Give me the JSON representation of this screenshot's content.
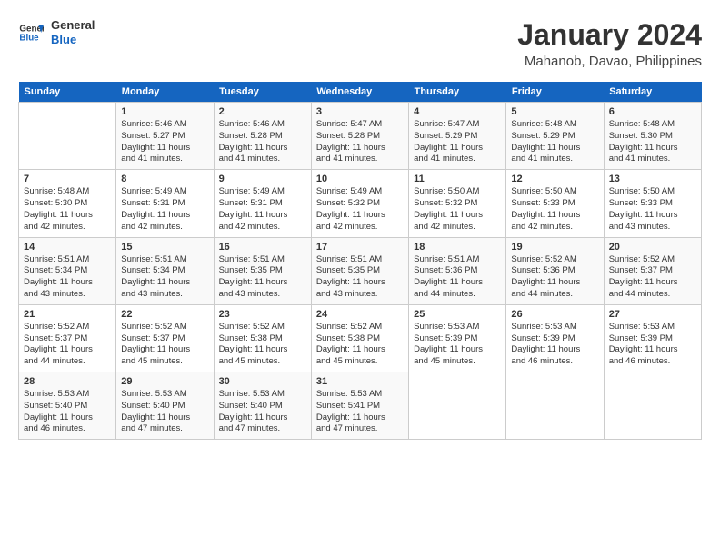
{
  "header": {
    "logo_line1": "General",
    "logo_line2": "Blue",
    "month_title": "January 2024",
    "location": "Mahanob, Davao, Philippines"
  },
  "days_of_week": [
    "Sunday",
    "Monday",
    "Tuesday",
    "Wednesday",
    "Thursday",
    "Friday",
    "Saturday"
  ],
  "weeks": [
    [
      {
        "day": "",
        "info": ""
      },
      {
        "day": "1",
        "info": "Sunrise: 5:46 AM\nSunset: 5:27 PM\nDaylight: 11 hours\nand 41 minutes."
      },
      {
        "day": "2",
        "info": "Sunrise: 5:46 AM\nSunset: 5:28 PM\nDaylight: 11 hours\nand 41 minutes."
      },
      {
        "day": "3",
        "info": "Sunrise: 5:47 AM\nSunset: 5:28 PM\nDaylight: 11 hours\nand 41 minutes."
      },
      {
        "day": "4",
        "info": "Sunrise: 5:47 AM\nSunset: 5:29 PM\nDaylight: 11 hours\nand 41 minutes."
      },
      {
        "day": "5",
        "info": "Sunrise: 5:48 AM\nSunset: 5:29 PM\nDaylight: 11 hours\nand 41 minutes."
      },
      {
        "day": "6",
        "info": "Sunrise: 5:48 AM\nSunset: 5:30 PM\nDaylight: 11 hours\nand 41 minutes."
      }
    ],
    [
      {
        "day": "7",
        "info": "Sunrise: 5:48 AM\nSunset: 5:30 PM\nDaylight: 11 hours\nand 42 minutes."
      },
      {
        "day": "8",
        "info": "Sunrise: 5:49 AM\nSunset: 5:31 PM\nDaylight: 11 hours\nand 42 minutes."
      },
      {
        "day": "9",
        "info": "Sunrise: 5:49 AM\nSunset: 5:31 PM\nDaylight: 11 hours\nand 42 minutes."
      },
      {
        "day": "10",
        "info": "Sunrise: 5:49 AM\nSunset: 5:32 PM\nDaylight: 11 hours\nand 42 minutes."
      },
      {
        "day": "11",
        "info": "Sunrise: 5:50 AM\nSunset: 5:32 PM\nDaylight: 11 hours\nand 42 minutes."
      },
      {
        "day": "12",
        "info": "Sunrise: 5:50 AM\nSunset: 5:33 PM\nDaylight: 11 hours\nand 42 minutes."
      },
      {
        "day": "13",
        "info": "Sunrise: 5:50 AM\nSunset: 5:33 PM\nDaylight: 11 hours\nand 43 minutes."
      }
    ],
    [
      {
        "day": "14",
        "info": "Sunrise: 5:51 AM\nSunset: 5:34 PM\nDaylight: 11 hours\nand 43 minutes."
      },
      {
        "day": "15",
        "info": "Sunrise: 5:51 AM\nSunset: 5:34 PM\nDaylight: 11 hours\nand 43 minutes."
      },
      {
        "day": "16",
        "info": "Sunrise: 5:51 AM\nSunset: 5:35 PM\nDaylight: 11 hours\nand 43 minutes."
      },
      {
        "day": "17",
        "info": "Sunrise: 5:51 AM\nSunset: 5:35 PM\nDaylight: 11 hours\nand 43 minutes."
      },
      {
        "day": "18",
        "info": "Sunrise: 5:51 AM\nSunset: 5:36 PM\nDaylight: 11 hours\nand 44 minutes."
      },
      {
        "day": "19",
        "info": "Sunrise: 5:52 AM\nSunset: 5:36 PM\nDaylight: 11 hours\nand 44 minutes."
      },
      {
        "day": "20",
        "info": "Sunrise: 5:52 AM\nSunset: 5:37 PM\nDaylight: 11 hours\nand 44 minutes."
      }
    ],
    [
      {
        "day": "21",
        "info": "Sunrise: 5:52 AM\nSunset: 5:37 PM\nDaylight: 11 hours\nand 44 minutes."
      },
      {
        "day": "22",
        "info": "Sunrise: 5:52 AM\nSunset: 5:37 PM\nDaylight: 11 hours\nand 45 minutes."
      },
      {
        "day": "23",
        "info": "Sunrise: 5:52 AM\nSunset: 5:38 PM\nDaylight: 11 hours\nand 45 minutes."
      },
      {
        "day": "24",
        "info": "Sunrise: 5:52 AM\nSunset: 5:38 PM\nDaylight: 11 hours\nand 45 minutes."
      },
      {
        "day": "25",
        "info": "Sunrise: 5:53 AM\nSunset: 5:39 PM\nDaylight: 11 hours\nand 45 minutes."
      },
      {
        "day": "26",
        "info": "Sunrise: 5:53 AM\nSunset: 5:39 PM\nDaylight: 11 hours\nand 46 minutes."
      },
      {
        "day": "27",
        "info": "Sunrise: 5:53 AM\nSunset: 5:39 PM\nDaylight: 11 hours\nand 46 minutes."
      }
    ],
    [
      {
        "day": "28",
        "info": "Sunrise: 5:53 AM\nSunset: 5:40 PM\nDaylight: 11 hours\nand 46 minutes."
      },
      {
        "day": "29",
        "info": "Sunrise: 5:53 AM\nSunset: 5:40 PM\nDaylight: 11 hours\nand 47 minutes."
      },
      {
        "day": "30",
        "info": "Sunrise: 5:53 AM\nSunset: 5:40 PM\nDaylight: 11 hours\nand 47 minutes."
      },
      {
        "day": "31",
        "info": "Sunrise: 5:53 AM\nSunset: 5:41 PM\nDaylight: 11 hours\nand 47 minutes."
      },
      {
        "day": "",
        "info": ""
      },
      {
        "day": "",
        "info": ""
      },
      {
        "day": "",
        "info": ""
      }
    ]
  ]
}
